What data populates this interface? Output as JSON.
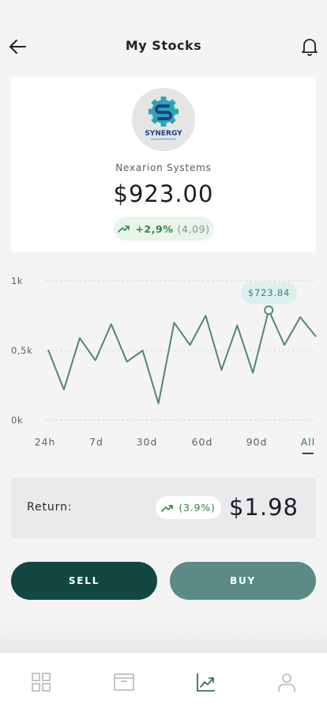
{
  "header": {
    "title": "My Stocks",
    "back_icon": "arrow-left-icon",
    "bell_icon": "bell-icon"
  },
  "stock": {
    "logo_text": "SYNERGY",
    "name": "Nexarion Systems",
    "price": "$923.00",
    "change_pct": "+2,9%",
    "change_abs": "(4,09)"
  },
  "chart_data": {
    "type": "line",
    "y_tick_labels": [
      "1k",
      "0,5k",
      "0k"
    ],
    "ylim": [
      0,
      1000
    ],
    "grid": true,
    "x": [
      0,
      1,
      2,
      3,
      4,
      5,
      6,
      7,
      8,
      9,
      10,
      11,
      12,
      13,
      14,
      15,
      16,
      17,
      18,
      19,
      20,
      21,
      22,
      23
    ],
    "values": [
      505,
      220,
      590,
      430,
      690,
      420,
      500,
      120,
      700,
      540,
      750,
      360,
      680,
      340,
      790,
      540,
      740,
      600
    ],
    "highlight": {
      "index": 14,
      "label": "$723.84"
    },
    "ranges": [
      "24h",
      "7d",
      "30d",
      "60d",
      "90d",
      "All"
    ],
    "active_range": "All",
    "colors": {
      "line": "#4f857f",
      "grid": "#d4d6d9"
    }
  },
  "return": {
    "label": "Return:",
    "pct": "(3.9%)",
    "value": "$1.98"
  },
  "actions": {
    "sell_label": "SELL",
    "buy_label": "BUY"
  },
  "tabs": [
    {
      "icon": "grid-icon",
      "active": false
    },
    {
      "icon": "wallet-icon",
      "active": false
    },
    {
      "icon": "chart-icon",
      "active": true
    },
    {
      "icon": "user-icon",
      "active": false
    }
  ],
  "colors": {
    "accent_dark": "#134742",
    "accent_light": "#5c8b85",
    "positive": "#2e8b45"
  }
}
